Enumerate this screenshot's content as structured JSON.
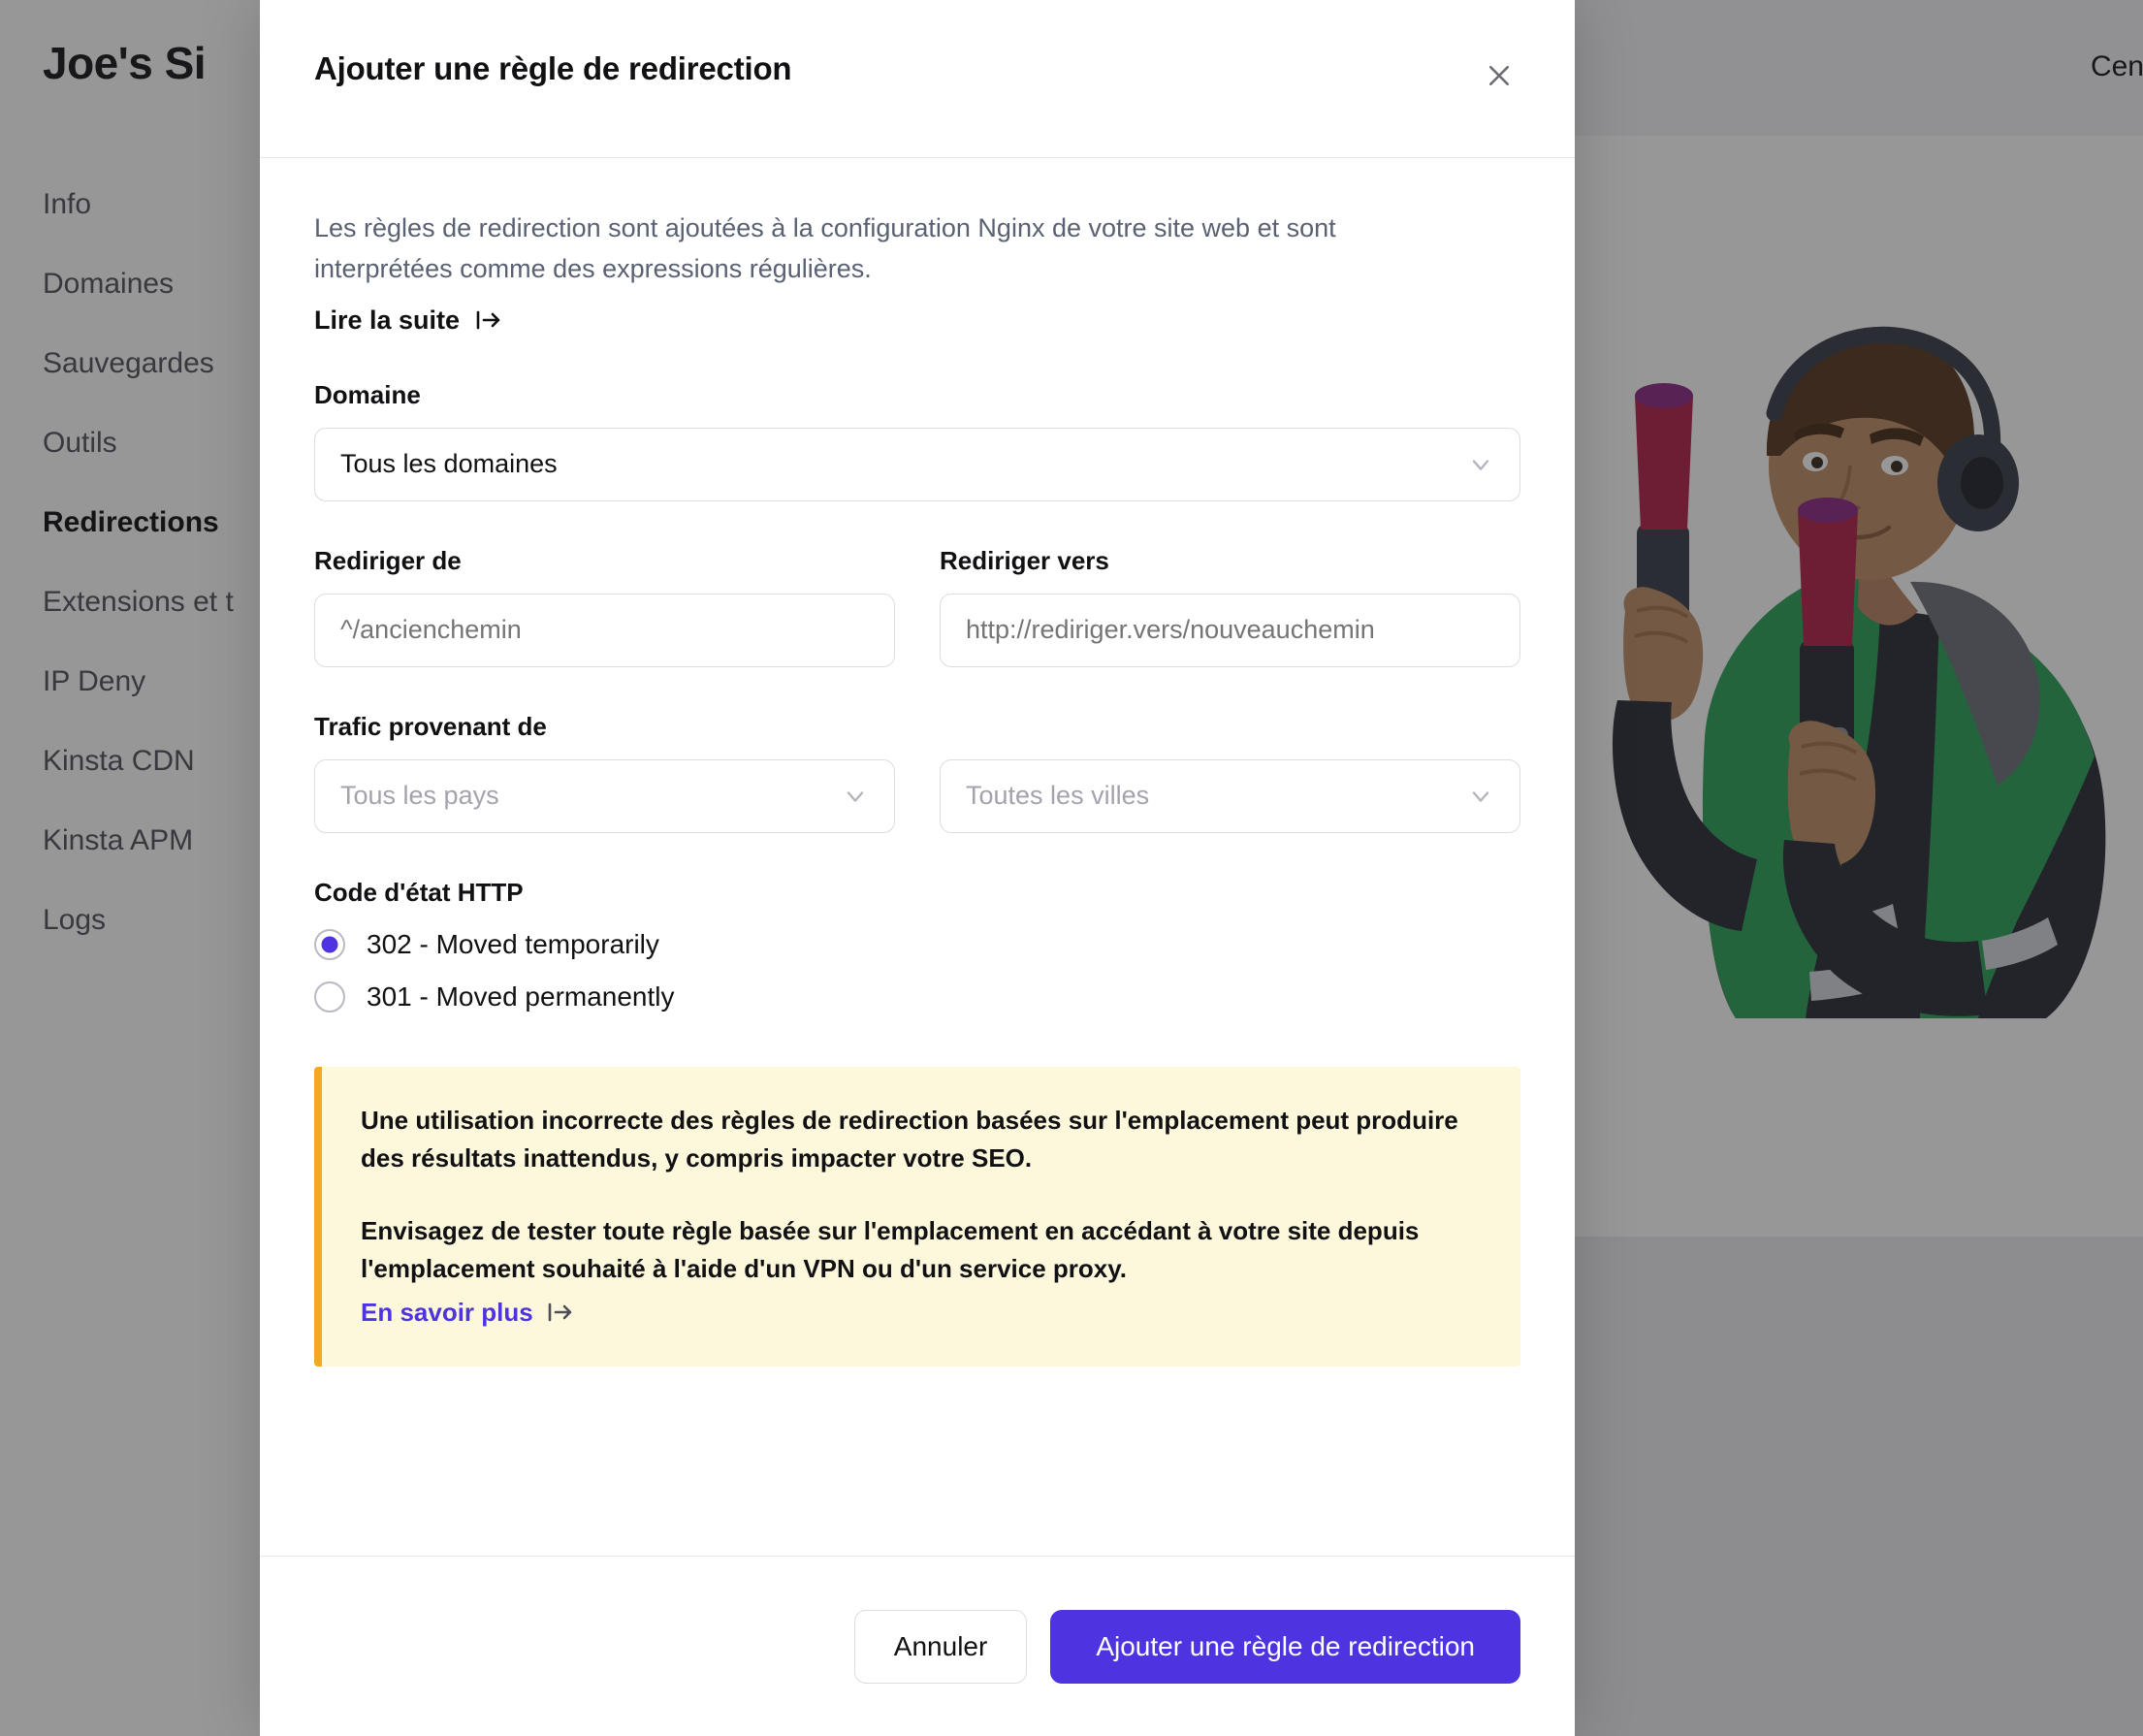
{
  "background": {
    "page_title": "Joe's Si",
    "top_right_label": "Centre",
    "nav": [
      {
        "label": "Info",
        "active": false
      },
      {
        "label": "Domaines",
        "active": false
      },
      {
        "label": "Sauvegardes",
        "active": false
      },
      {
        "label": "Outils",
        "active": false
      },
      {
        "label": "Redirections",
        "active": true
      },
      {
        "label": "Extensions et t",
        "active": false
      },
      {
        "label": "IP Deny",
        "active": false
      },
      {
        "label": "Kinsta CDN",
        "active": false
      },
      {
        "label": "Kinsta APM",
        "active": false
      },
      {
        "label": "Logs",
        "active": false
      }
    ],
    "illustration_alt": "support-agent-illustration"
  },
  "modal": {
    "title": "Ajouter une règle de redirection",
    "close_icon": "close-icon",
    "intro": "Les règles de redirection sont ajoutées à la configuration Nginx de votre site web et sont interprétées comme des expressions régulières.",
    "read_more_label": "Lire la suite",
    "read_more_icon": "external-link-icon",
    "domain": {
      "label": "Domaine",
      "value": "Tous les domaines",
      "chevron_icon": "chevron-down-icon"
    },
    "redirect_from": {
      "label": "Rediriger de",
      "value": "",
      "placeholder": "^/ancienchemin"
    },
    "redirect_to": {
      "label": "Rediriger vers",
      "value": "",
      "placeholder": "http://rediriger.vers/nouveauchemin"
    },
    "traffic": {
      "label": "Trafic provenant de",
      "country_placeholder": "Tous les pays",
      "city_placeholder": "Toutes les villes",
      "chevron_icon": "chevron-down-icon"
    },
    "status_code": {
      "label": "Code d'état HTTP",
      "options": [
        {
          "label": "302 - Moved temporarily",
          "selected": true
        },
        {
          "label": "301 - Moved permanently",
          "selected": false
        }
      ]
    },
    "warning": {
      "paragraph_1": "Une utilisation incorrecte des règles de redirection basées sur l'emplacement peut produire des résultats inattendus, y compris impacter votre SEO.",
      "paragraph_2": "Envisagez de tester toute règle basée sur l'emplacement en accédant à votre site depuis l'emplacement souhaité à l'aide d'un VPN ou d'un service proxy.",
      "link_label": "En savoir plus",
      "link_icon": "external-link-icon",
      "accent_color": "#f5a623",
      "background_color": "#fdf8dc"
    },
    "footer": {
      "cancel_label": "Annuler",
      "submit_label": "Ajouter une règle de redirection"
    }
  },
  "colors": {
    "accent": "#4e34e1",
    "warning_bar": "#f5a623",
    "warning_bg": "#fdf8dc",
    "text_primary": "#111114",
    "text_muted": "#5a6173",
    "border": "#dcdce3"
  }
}
